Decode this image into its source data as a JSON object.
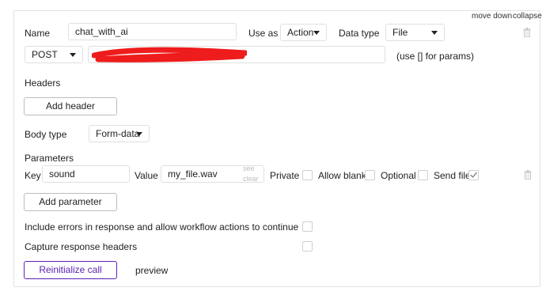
{
  "top_links": {
    "move_down": "move down",
    "collapse": "collapse"
  },
  "call": {
    "name_label": "Name",
    "name_value": "chat_with_ai",
    "use_as_label": "Use as",
    "use_as_value": "Action",
    "data_type_label": "Data type",
    "data_type_value": "File",
    "method_value": "POST",
    "params_hint": "(use [] for params)"
  },
  "headers": {
    "title": "Headers",
    "add_button": "Add header"
  },
  "body_type": {
    "label": "Body type",
    "value": "Form-data"
  },
  "parameters": {
    "title": "Parameters",
    "row": {
      "key_label": "Key",
      "key_value": "sound",
      "value_label": "Value",
      "value_value": "my_file.wav",
      "see_link": "see",
      "clear_link": "clear",
      "private_label": "Private",
      "allow_blank_label": "Allow blank",
      "optional_label": "Optional",
      "send_file_label": "Send file",
      "send_file_checked": true
    },
    "add_button": "Add parameter"
  },
  "options": {
    "include_errors_label": "Include errors in response and allow workflow actions to continue",
    "capture_headers_label": "Capture response headers"
  },
  "actions": {
    "reinitialize_button": "Reinitialize call",
    "preview_link": "preview"
  },
  "colors": {
    "accent_purple": "#5b21b6",
    "redaction_red": "#ee1c1c",
    "border": "#e0e0e0"
  }
}
